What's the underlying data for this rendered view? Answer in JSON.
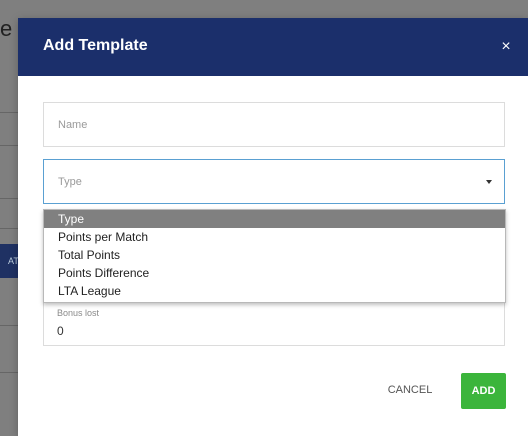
{
  "modal": {
    "title": "Add Template",
    "close_symbol": "×",
    "name_field": {
      "placeholder": "Name",
      "value": ""
    },
    "type_field": {
      "value": "Type",
      "icon": "caret-down-icon"
    },
    "bonus_field": {
      "label": "Bonus lost",
      "value": "0"
    },
    "cancel_label": "CANCEL",
    "add_label": "ADD"
  },
  "dropdown": {
    "options": [
      "Type",
      "Points per Match",
      "Total Points",
      "Points Difference",
      "LTA League"
    ],
    "selected_index": 0
  },
  "colors": {
    "header": "#1b2f6b",
    "add_button": "#3bb53b",
    "focus_border": "#5aa0d2",
    "selected_option": "#808080",
    "overlay": "#7f7f7f"
  }
}
